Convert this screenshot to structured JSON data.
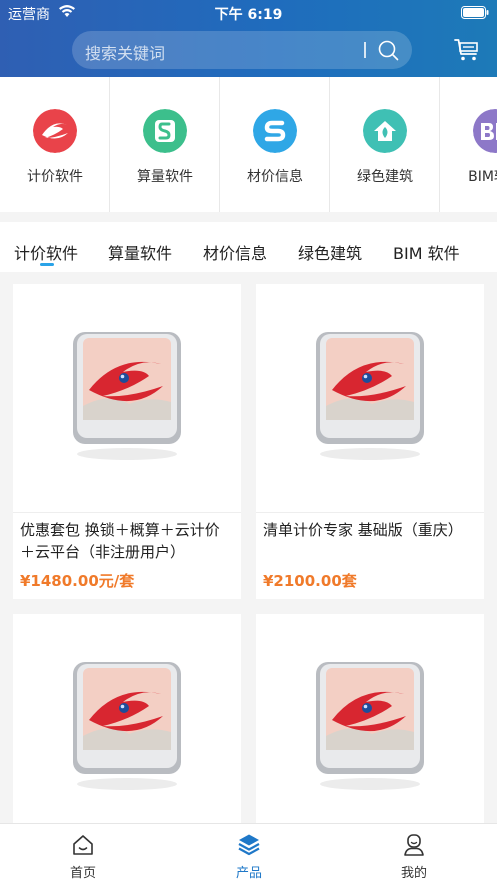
{
  "status_bar": {
    "carrier": "运营商",
    "time": "下午 6:19"
  },
  "search": {
    "placeholder": "搜索关键词"
  },
  "categories": [
    {
      "label": "计价软件",
      "icon": "e-logo-icon",
      "color": "#e9434a"
    },
    {
      "label": "算量软件",
      "icon": "s-logo-icon",
      "color": "#3cbf8c"
    },
    {
      "label": "材价信息",
      "icon": "s-price-icon",
      "color": "#2fa7e6"
    },
    {
      "label": "绿色建筑",
      "icon": "green-house-icon",
      "color": "#3fc0b4"
    },
    {
      "label": "BIM软件",
      "icon": "bim-icon",
      "color": "#8d78c8"
    }
  ],
  "tabs": [
    {
      "label": "计价软件",
      "active": true
    },
    {
      "label": "算量软件"
    },
    {
      "label": "材价信息"
    },
    {
      "label": "绿色建筑"
    },
    {
      "label": "BIM 软件"
    }
  ],
  "products": [
    {
      "title": "优惠套包 换锁＋概算＋云计价＋云平台（非注册用户）",
      "price": "¥1480.00元/套"
    },
    {
      "title": "清单计价专家 基础版（重庆）",
      "price": "¥2100.00套"
    },
    {
      "title": "",
      "price": ""
    },
    {
      "title": "",
      "price": ""
    }
  ],
  "bottom_nav": [
    {
      "label": "首页",
      "icon": "home-icon"
    },
    {
      "label": "产品",
      "icon": "product-cube-icon",
      "active": true
    },
    {
      "label": "我的",
      "icon": "profile-icon"
    }
  ],
  "colors": {
    "accent": "#1f78c8",
    "price": "#f07a2a",
    "tab_indicator": "#2aa3e8"
  }
}
